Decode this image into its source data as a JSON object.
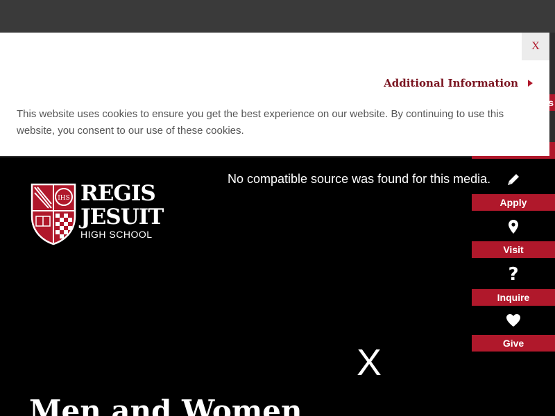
{
  "cookie_banner": {
    "close_label": "X",
    "additional_info_label": "Additional Information",
    "message": "This website uses cookies to ensure you get the best experience on our website. By continuing to use this website, you consent to our use of these cookies."
  },
  "hero": {
    "media_message": "No compatible source was found for this media.",
    "close_label": "X",
    "headline": "Men and Women"
  },
  "logo": {
    "line1": "REGIS",
    "line2": "JESUIT",
    "line3": "HIGH SCHOOL",
    "seal_letters": "IHS"
  },
  "side_nav": {
    "partial_label": "s",
    "items": [
      {
        "label": "Apply",
        "icon": "pencil-icon"
      },
      {
        "label": "Visit",
        "icon": "map-pin-icon"
      },
      {
        "label": "Inquire",
        "icon": "question-icon"
      },
      {
        "label": "Give",
        "icon": "heart-icon"
      }
    ]
  },
  "colors": {
    "brand_red": "#b0182b",
    "dark_red_text": "#7a1420",
    "background": "#000000"
  }
}
